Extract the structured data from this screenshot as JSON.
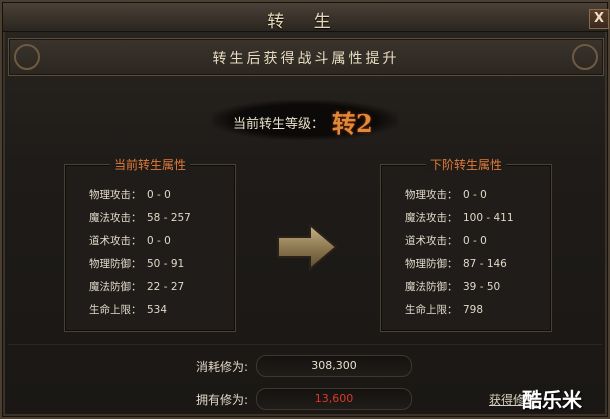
{
  "window": {
    "title": "转 生",
    "close_label": "X",
    "close_icon": "close-icon"
  },
  "header": {
    "subtitle": "转生后获得战斗属性提升"
  },
  "level": {
    "label": "当前转生等级：",
    "value": "转2"
  },
  "current": {
    "title": "当前转生属性",
    "attrs": [
      {
        "name": "物理攻击：",
        "value": "0 - 0"
      },
      {
        "name": "魔法攻击：",
        "value": "58 - 257"
      },
      {
        "name": "道术攻击：",
        "value": "0 - 0"
      },
      {
        "name": "物理防御：",
        "value": "50 - 91"
      },
      {
        "name": "魔法防御：",
        "value": "22 - 27"
      },
      {
        "name": "生命上限：",
        "value": "534"
      }
    ]
  },
  "next": {
    "title": "下阶转生属性",
    "attrs": [
      {
        "name": "物理攻击：",
        "value": "0 - 0"
      },
      {
        "name": "魔法攻击：",
        "value": "100 - 411"
      },
      {
        "name": "道术攻击：",
        "value": "0 - 0"
      },
      {
        "name": "物理防御：",
        "value": "87 - 146"
      },
      {
        "name": "魔法防御：",
        "value": "39 - 50"
      },
      {
        "name": "生命上限：",
        "value": "798"
      }
    ]
  },
  "cost": {
    "label": "消耗修为:",
    "value": "308,300"
  },
  "owned": {
    "label": "拥有修为:",
    "value": "13,600"
  },
  "link": {
    "label": "获得修为"
  },
  "watermark": {
    "text": "酷乐米"
  },
  "colors": {
    "accent": "#e07b3a",
    "owned_value": "#d83a2a",
    "level_value": "#e08a3a"
  },
  "icons": {
    "arrow": "arrow-right-icon"
  }
}
